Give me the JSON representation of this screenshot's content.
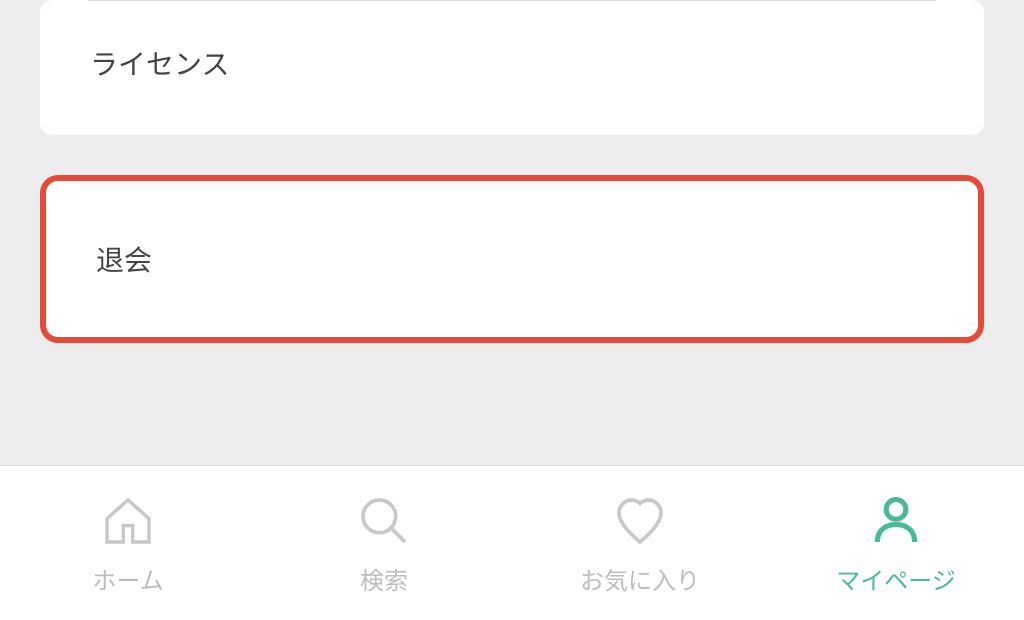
{
  "settings": {
    "license_label": "ライセンス",
    "withdraw_label": "退会"
  },
  "nav": {
    "items": [
      {
        "label": "ホーム"
      },
      {
        "label": "検索"
      },
      {
        "label": "お気に入り"
      },
      {
        "label": "マイページ"
      }
    ]
  },
  "colors": {
    "accent": "#4bb89a",
    "highlight_border": "#e44a3a",
    "inactive": "#bdbdbd"
  }
}
